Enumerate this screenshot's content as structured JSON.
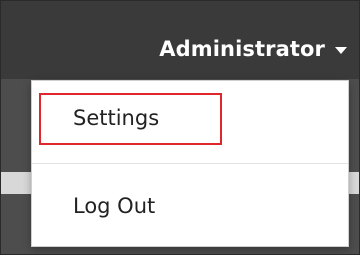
{
  "header": {
    "account_label": "Administrator",
    "caret_icon": "chevron-down-icon"
  },
  "menu": {
    "items": [
      {
        "label": "Settings",
        "highlighted": true
      },
      {
        "label": "Log Out",
        "highlighted": false
      }
    ]
  },
  "colors": {
    "topbar": "#3a3a3a",
    "menu_background": "#ffffff",
    "highlight_border": "#e0262d",
    "text_dark": "#222222",
    "text_light": "#ffffff"
  }
}
